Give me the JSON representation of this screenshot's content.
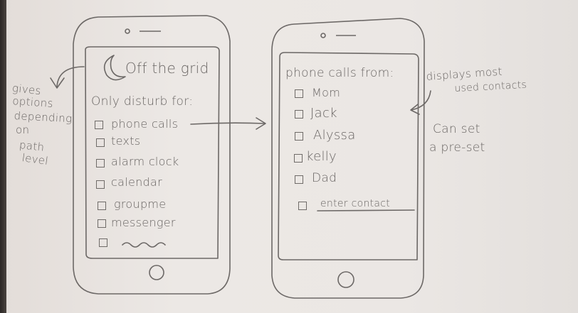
{
  "annotations": {
    "left_note_lines": [
      "gives",
      "options",
      "depending",
      "on",
      "path",
      "level"
    ],
    "right_note_lines": [
      "displays most",
      "used contacts"
    ],
    "preset_note_lines": [
      "Can set",
      "a pre-set"
    ]
  },
  "left_phone": {
    "title": "Off the grid",
    "heading": "Only disturb for:",
    "options": [
      "phone calls",
      "texts",
      "alarm clock",
      "calendar",
      "groupme",
      "messenger"
    ]
  },
  "right_phone": {
    "heading": "phone calls from:",
    "contacts": [
      "Mom",
      "Jack",
      "Alyssa",
      "kelly",
      "Dad"
    ],
    "enter_contact": "enter contact"
  }
}
